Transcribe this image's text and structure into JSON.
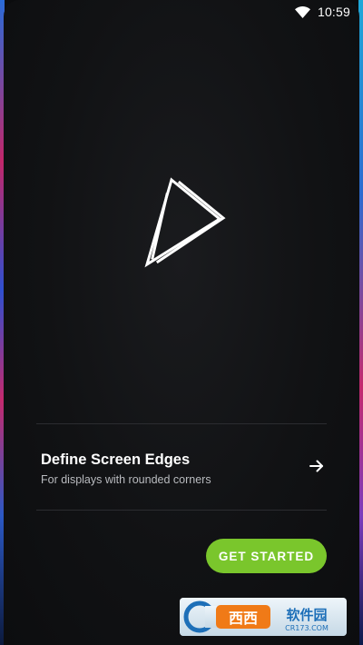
{
  "status_bar": {
    "time": "10:59",
    "icons": [
      "wifi-icon"
    ]
  },
  "logo": {
    "icon": "triangle-play-logo-icon"
  },
  "setup_option": {
    "title": "Define Screen Edges",
    "subtitle": "For displays with rounded corners",
    "icon": "arrow-right-icon"
  },
  "cta": {
    "label": "GET STARTED"
  },
  "watermark": {
    "brand": "西西软件园",
    "domain": "CR173.COM"
  },
  "colors": {
    "accent": "#7ac62c",
    "background": "#111214",
    "divider": "#2b2c30",
    "edge_pink": "#c42a6e",
    "edge_blue": "#2b58c4"
  }
}
